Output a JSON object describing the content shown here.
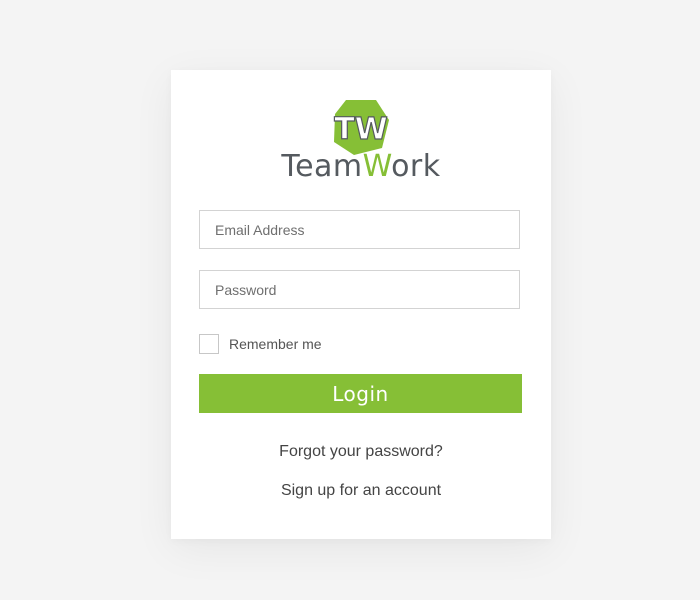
{
  "brand": {
    "logo_letters": "TW",
    "name_part1": "Team",
    "name_part2": "W",
    "name_part3": "ork",
    "accent_color": "#86bf36",
    "text_color": "#555a5f"
  },
  "form": {
    "email_placeholder": "Email Address",
    "password_placeholder": "Password",
    "remember_label": "Remember me",
    "remember_checked": false,
    "login_label": "Login"
  },
  "links": {
    "forgot": "Forgot your password?",
    "signup": "Sign up for an account"
  },
  "icons": {
    "logo": "teamwork-hexagon-logo-icon",
    "checkbox": "checkbox-icon"
  }
}
